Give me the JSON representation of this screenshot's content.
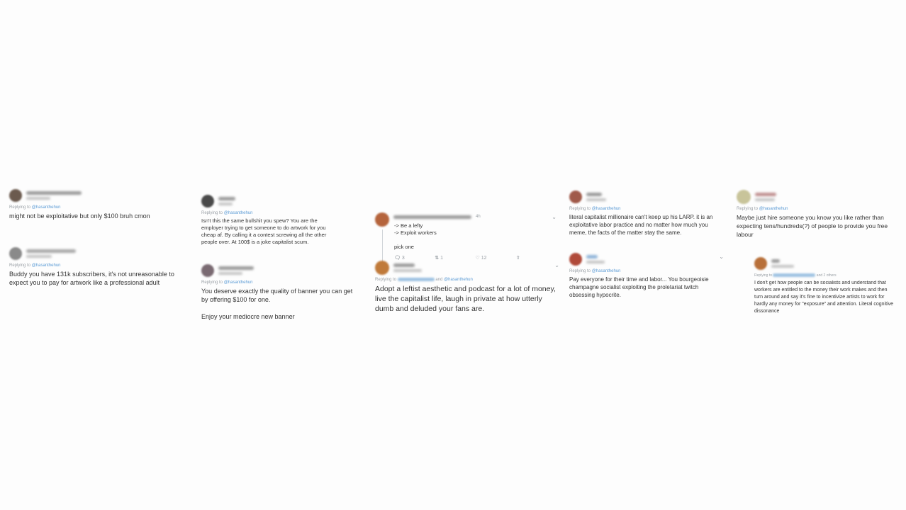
{
  "columns": [
    {
      "tweets": [
        {
          "replying_prefix": "Replying to",
          "mention": "@hasanthehun",
          "text": "might not be exploitative but only $100 bruh cmon",
          "avatar_color": "#6b5a4e"
        },
        {
          "replying_prefix": "Replying to",
          "mention": "@hasanthehun",
          "text": "Buddy you have 131k subscribers, it's not unreasonable to expect you to pay for artwork like a professional adult",
          "avatar_color": "#8a8a8a"
        }
      ]
    },
    {
      "tweets": [
        {
          "replying_prefix": "Replying to",
          "mention": "@hasanthehun",
          "text": "Isn't this the same bullshit you spew? You are the employer trying to get someone to do artwork for you cheap af. By calling it a contest screwing all the other people over. At 100$ is a joke capitalist scum.",
          "avatar_color": "#4a4a4a"
        },
        {
          "replying_prefix": "Replying to",
          "mention": "@hasanthehun",
          "text": "You deserve exactly the quality of banner you can get by offering $100 for one.\n\nEnjoy your mediocre new banner",
          "avatar_color": "#7a6a72"
        }
      ]
    },
    {
      "tweets": [
        {
          "timestamp": "4h",
          "text": "-> Be a lefty\n-> Exploit workers\n\npick one",
          "avatar_color": "#b5643c",
          "actions": {
            "reply": "3",
            "retweet": "1",
            "like": "12"
          }
        },
        {
          "replying_prefix": "Replying to",
          "and_word": "and",
          "mention": "@hasanthehun",
          "text": "Adopt a leftist aesthetic and podcast for a lot of money, live the capitalist life, laugh in private at how utterly dumb and deluded your fans are.",
          "avatar_color": "#c07a3a"
        }
      ]
    },
    {
      "tweets": [
        {
          "replying_prefix": "Replying to",
          "mention": "@hasanthehun",
          "text": "literal capitalist millionaire can't keep up his LARP. it is an exploitative labor practice and no matter how much you meme, the facts of the matter stay the same.",
          "avatar_color": "#a05a4a"
        },
        {
          "replying_prefix": "Replying to",
          "mention": "@hasanthehun",
          "text": "Pay everyone for their time and labor... You bourgeoisie champagne socialist exploiting the proletariat twitch obsessing hypocrite.",
          "avatar_color": "#b04a3a"
        }
      ]
    },
    {
      "tweets": [
        {
          "replying_prefix": "Replying to",
          "mention": "@hasanthehun",
          "text": "Maybe just hire someone you know you like rather than expecting tens/hundreds(?) of people to provide you free labour",
          "avatar_color": "#c8c49a"
        },
        {
          "replying_prefix": "Replying to",
          "and_more": "and 2 others",
          "text": "I don't get how people can be socialists and understand that workers are entitled to the money their work makes and then turn around and say it's fine to incentivize artists to work for hardly any money for \"exposure\" and attention. Literal cognitive dissonance",
          "avatar_color": "#b8703a"
        }
      ]
    }
  ],
  "icons": {
    "reply": "speech-bubble",
    "retweet": "retweet-arrows",
    "like": "heart",
    "share": "share-arrow",
    "chevron": "chevron-down"
  }
}
